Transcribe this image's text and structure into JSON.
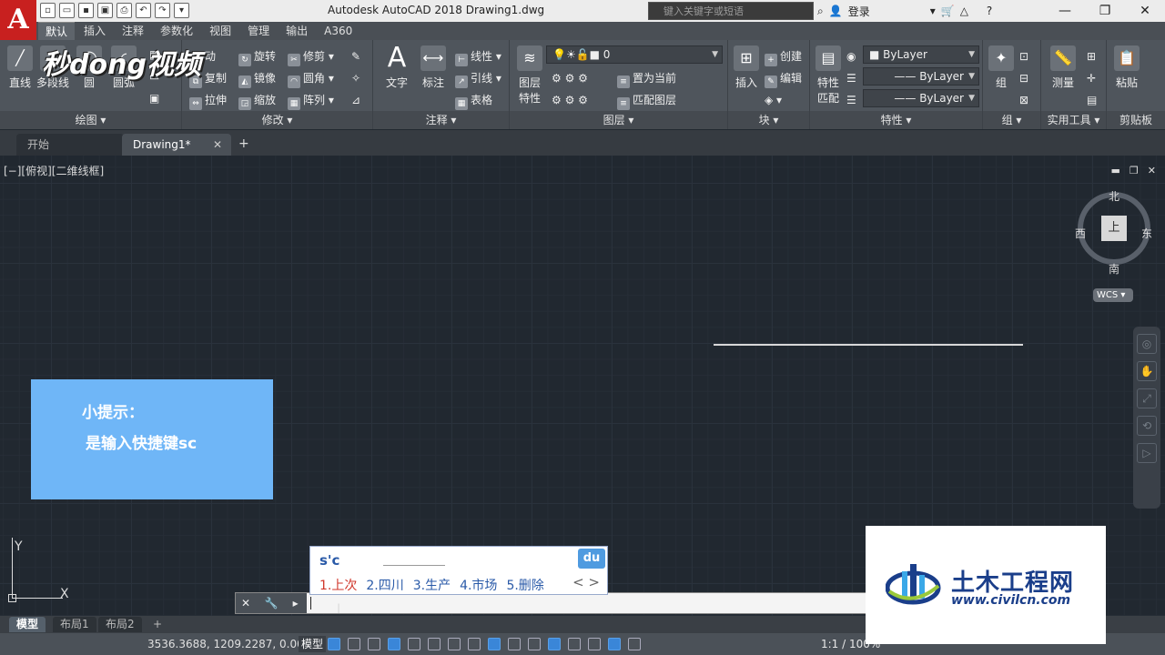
{
  "app": {
    "logo_letter": "A",
    "title": "Autodesk AutoCAD 2018    Drawing1.dwg"
  },
  "search": {
    "placeholder": "键入关键字或短语"
  },
  "topbar": {
    "login": "登录"
  },
  "ribbon_tabs": [
    "默认",
    "插入",
    "注释",
    "参数化",
    "视图",
    "管理",
    "输出",
    "A360"
  ],
  "panels": {
    "draw": {
      "title": "绘图",
      "line": "直线",
      "polyline": "多段线",
      "circle": "圆",
      "arc": "圆弧"
    },
    "modify": {
      "title": "修改",
      "move": "动",
      "rotate": "旋转",
      "trim": "修剪",
      "copy": "复制",
      "mirror": "镜像",
      "fillet": "圆角",
      "stretch": "拉伸",
      "scale": "缩放",
      "array": "阵列"
    },
    "annotation": {
      "title": "注释",
      "text": "文字",
      "dimension": "标注",
      "linear": "线性",
      "leader": "引线",
      "table": "表格"
    },
    "layers": {
      "title": "图层",
      "properties_line1": "图层",
      "properties_line2": "特性",
      "current_layer": "0",
      "set_current": "置为当前",
      "match_layer": "匹配图层"
    },
    "block": {
      "title": "块",
      "insert": "插入",
      "create": "创建",
      "edit": "编辑"
    },
    "properties": {
      "title": "特性",
      "match_line1": "特性",
      "match_line2": "匹配",
      "color": "ByLayer",
      "linetype": "ByLayer",
      "lineweight": "ByLayer"
    },
    "group": {
      "title": "组",
      "group": "组"
    },
    "utilities": {
      "title": "实用工具",
      "measure": "测量"
    },
    "clipboard": {
      "title": "剪贴板",
      "paste": "粘贴"
    }
  },
  "watermark_top": "秒dong视频",
  "doc_tabs": {
    "start": "开始",
    "drawing": "Drawing1*",
    "add": "+"
  },
  "viewport": {
    "label": "[−][俯视][二维线框]"
  },
  "viewcube": {
    "top": "上",
    "north": "北",
    "south": "南",
    "east": "东",
    "west": "西",
    "wcs": "WCS"
  },
  "tip": {
    "title": "小提示：",
    "body": "是输入快捷键sc"
  },
  "ucs": {
    "x": "X",
    "y": "Y"
  },
  "ime": {
    "input": "s'c",
    "logo": "du",
    "candidates": [
      "1.上次",
      "2.四川",
      "3.生产",
      "4.市场",
      "5.删除"
    ],
    "nav": "<  >"
  },
  "cmd": {
    "tools": "✕ 🔧 ▸"
  },
  "layout_tabs": [
    "模型",
    "布局1",
    "布局2",
    "+"
  ],
  "status": {
    "coords": "3536.3688, 1209.2287, 0.0000",
    "model": "模型",
    "scale": "1:1 / 100%"
  },
  "civil": {
    "name": "土木工程网",
    "url": "www.civilcn.com"
  },
  "colors": {
    "tip_bg": "#6fb6f7",
    "canvas_bg": "#212830",
    "accent_red": "#c8201f"
  }
}
